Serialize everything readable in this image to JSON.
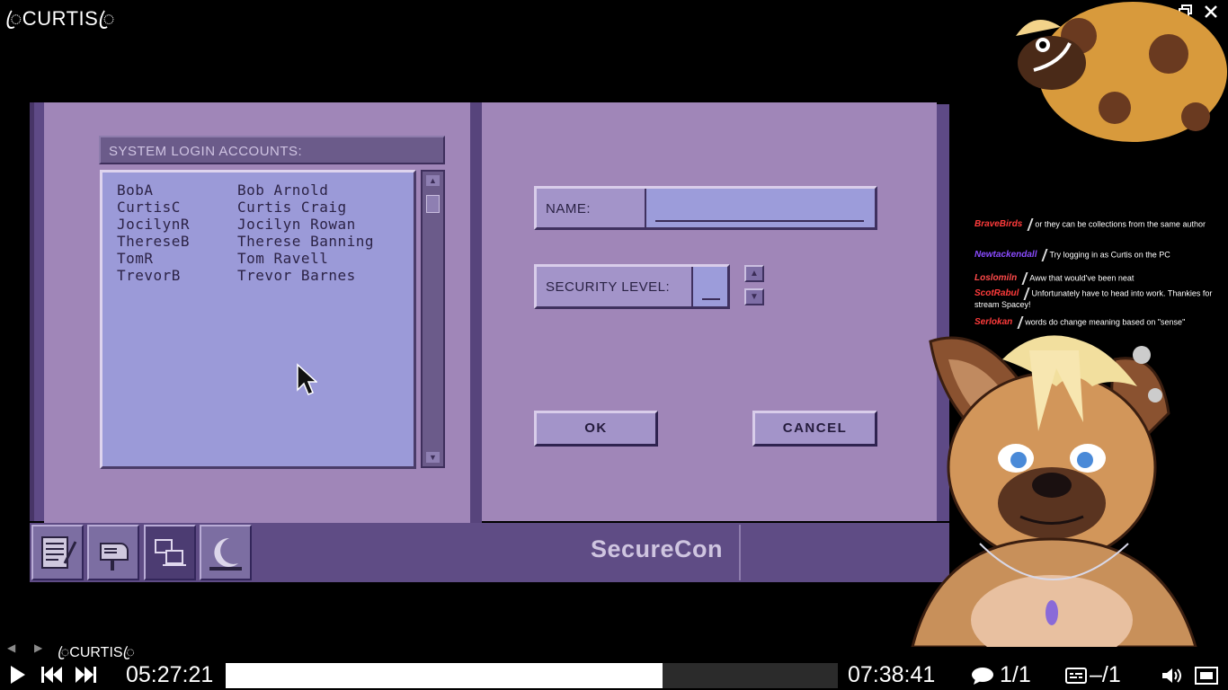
{
  "window": {
    "title": "ꦿCURTISꦿ",
    "minimize_icon": "minimize-icon",
    "maximize_icon": "restore-icon",
    "close_icon": "close-icon"
  },
  "game": {
    "accounts_header": "SYSTEM LOGIN ACCOUNTS:",
    "accounts": [
      {
        "user": "BobA",
        "name": "Bob Arnold"
      },
      {
        "user": "CurtisC",
        "name": "Curtis Craig"
      },
      {
        "user": "JocilynR",
        "name": "Jocilyn Rowan"
      },
      {
        "user": "ThereseB",
        "name": "Therese Banning"
      },
      {
        "user": "TomR",
        "name": "Tom Ravell"
      },
      {
        "user": "TrevorB",
        "name": "Trevor Barnes"
      }
    ],
    "name_label": "NAME:",
    "name_value": "",
    "security_label": "SECURITY LEVEL:",
    "security_value": "",
    "ok_label": "OK",
    "cancel_label": "CANCEL",
    "taskbar_title": "SecureCon",
    "taskbar_icons": [
      "notepad-icon",
      "mailbox-icon",
      "computer-network-icon",
      "moon-icon"
    ]
  },
  "chat": [
    {
      "user": "BraveBirds",
      "color": "#ff3b3b",
      "text": "or they can be collections from the same author"
    },
    {
      "user": "Newtackendall",
      "color": "#8a4bff",
      "text": "Try logging in as Curtis on the PC"
    },
    {
      "user": "Loslomiln",
      "color": "#ff4a4a",
      "text": "Aww that would've been neat"
    },
    {
      "user": "ScotRabul",
      "color": "#ff3b3b",
      "text": "Unfortunately have to head into work. Thankies for stream Spacey!"
    },
    {
      "user": "Serlokan",
      "color": "#ff3b3b",
      "text": "words do change meaning based on \"sense\""
    }
  ],
  "player": {
    "file_label": "ꦿCURTISꦿ",
    "current_time": "05:27:21",
    "total_time": "07:38:41",
    "progress": 0.714,
    "chapter_counter": "1/1",
    "subtitle_counter": "–/1"
  }
}
